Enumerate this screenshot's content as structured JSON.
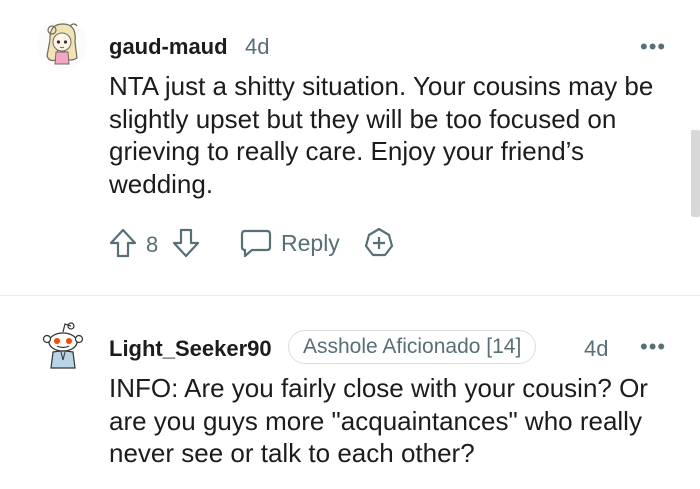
{
  "comments": [
    {
      "author": "gaud-maud",
      "age": "4d",
      "body": "NTA just a shitty situation. Your cousins may be slightly upset but they will be too focused on grieving to really care. Enjoy your friend’s wedding.",
      "score": "8",
      "reply_label": "Reply",
      "avatar_icon": "anime-girl-avatar-icon"
    },
    {
      "author": "Light_Seeker90",
      "flair": "Asshole Aficionado [14]",
      "age": "4d",
      "body": "INFO: Are you fairly close with your cousin? Or are you guys more \"acquaintances\" who really never see or talk to each other?",
      "avatar_icon": "snoo-avatar-icon"
    }
  ],
  "more_label": "•••",
  "colors": {
    "text": "#1c1c1c",
    "muted": "#576f76",
    "divider": "#e5ebee"
  }
}
